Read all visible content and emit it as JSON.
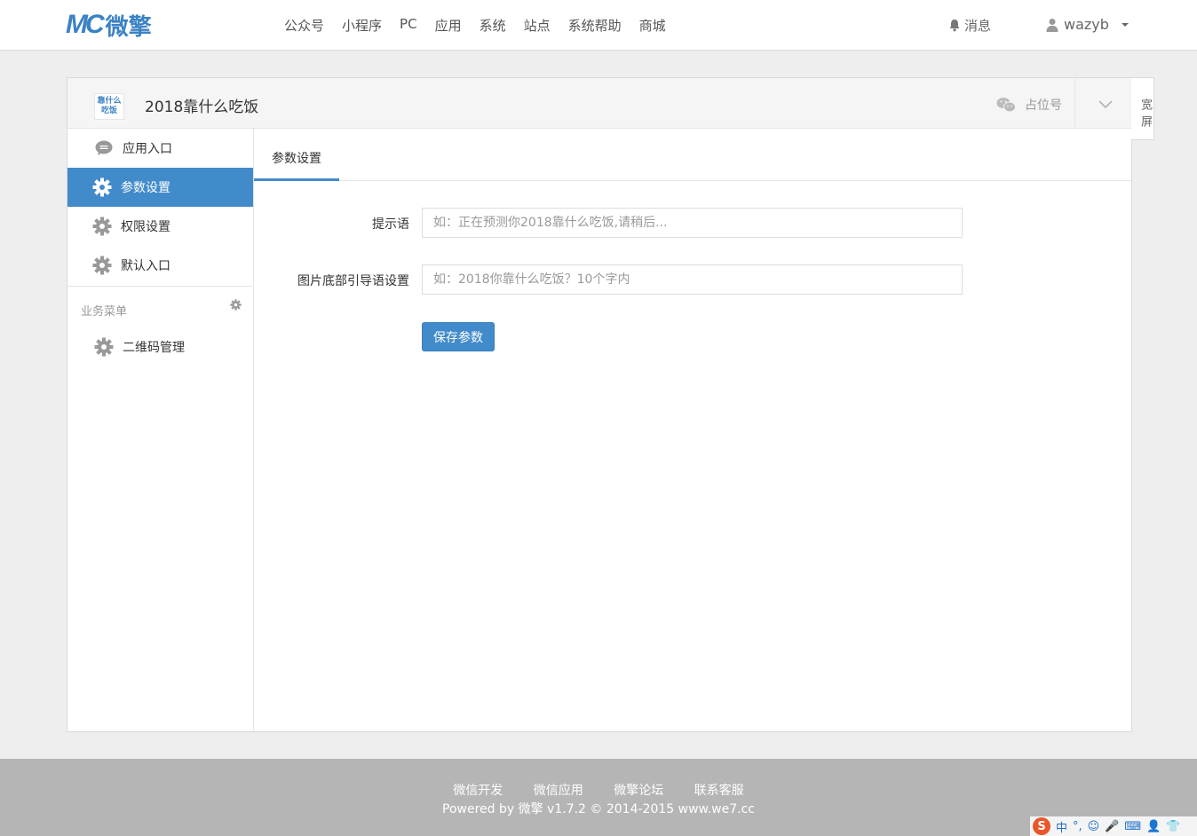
{
  "brand": {
    "mark": "MC",
    "name": "微擎"
  },
  "nav": {
    "items": [
      "公众号",
      "小程序",
      "PC",
      "应用",
      "系统",
      "站点",
      "系统帮助",
      "商城"
    ]
  },
  "topright": {
    "messages": "消息",
    "user": "wazyb"
  },
  "panel": {
    "app_icon_text": "靠什么吃饭",
    "app_title": "2018靠什么吃饭",
    "account_label": "占位号",
    "wide_screen": "宽屏"
  },
  "sidebar": {
    "items": [
      {
        "label": "应用入口",
        "icon": "comment-icon",
        "active": false
      },
      {
        "label": "参数设置",
        "icon": "gear-icon",
        "active": true
      },
      {
        "label": "权限设置",
        "icon": "gear-icon",
        "active": false
      },
      {
        "label": "默认入口",
        "icon": "gear-icon",
        "active": false
      }
    ],
    "section_label": "业务菜单",
    "section_items": [
      {
        "label": "二维码管理",
        "icon": "gear-icon"
      }
    ]
  },
  "content": {
    "tab": "参数设置",
    "fields": [
      {
        "label": "提示语",
        "placeholder": "如：正在预测你2018靠什么吃饭,请稍后...",
        "value": ""
      },
      {
        "label": "图片底部引导语设置",
        "placeholder": "如：2018你靠什么吃饭？10个字内",
        "value": ""
      }
    ],
    "save_label": "保存参数"
  },
  "footer": {
    "links": [
      "微信开发",
      "微信应用",
      "微擎论坛",
      "联系客服"
    ],
    "copyright": "Powered by 微擎 v1.7.2 © 2014-2015 www.we7.cc"
  },
  "ime": {
    "items": [
      "S",
      "中",
      "°,",
      "☺",
      "🎤",
      "⌨",
      "👤",
      "👕"
    ]
  },
  "colors": {
    "primary": "#428bca",
    "brand": "#3b82c4",
    "footer": "#b5b5b5"
  }
}
